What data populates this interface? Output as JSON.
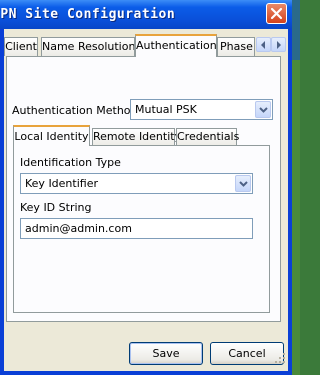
{
  "window": {
    "title": "VPN Site Configuration"
  },
  "tabs": [
    {
      "label": "Client"
    },
    {
      "label": "Name Resolution"
    },
    {
      "label": "Authentication"
    },
    {
      "label": "Phase"
    }
  ],
  "auth": {
    "method_label": "Authentication Method",
    "method_value": "Mutual PSK"
  },
  "subtabs": [
    {
      "label": "Local Identity"
    },
    {
      "label": "Remote Identity"
    },
    {
      "label": "Credentials"
    }
  ],
  "local_identity": {
    "id_type_label": "Identification Type",
    "id_type_value": "Key Identifier",
    "key_id_label": "Key ID String",
    "key_id_value": "admin@admin.com"
  },
  "buttons": {
    "save": "Save",
    "cancel": "Cancel"
  },
  "colors": {
    "titlebar": "#0a4fd9",
    "dialog_bg": "#ece9d8",
    "active_tab_accent": "#e8a33c"
  }
}
